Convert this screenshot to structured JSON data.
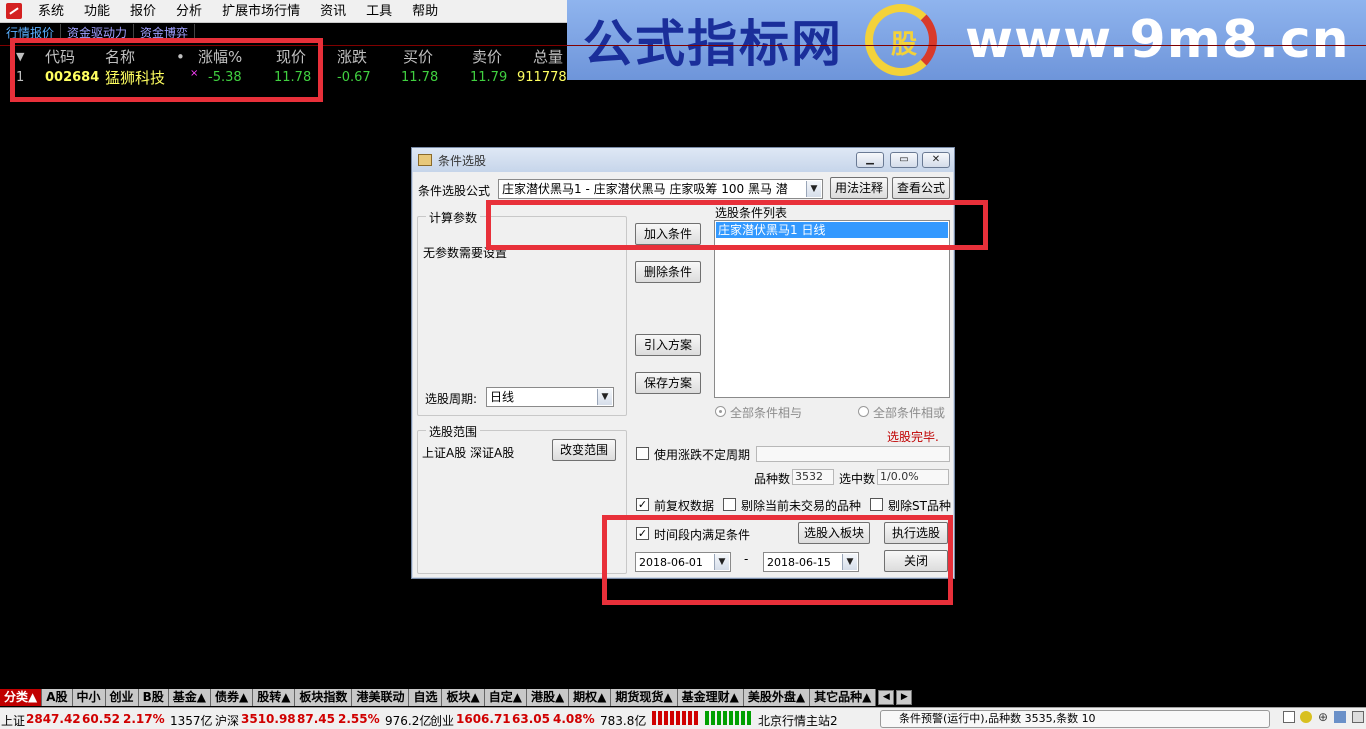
{
  "menu": [
    "系统",
    "功能",
    "报价",
    "分析",
    "扩展市场行情",
    "资讯",
    "工具",
    "帮助"
  ],
  "subtabs": [
    "行情报价",
    "资金驱动力",
    "资金博弈"
  ],
  "banner": {
    "title": "公式指标网",
    "logo_text": "股",
    "url": "www.9m8.cn"
  },
  "quote": {
    "headers": [
      "代码",
      "名称",
      "•",
      "涨幅%",
      "现价",
      "涨跌",
      "买价",
      "卖价",
      "总量"
    ],
    "row": {
      "index": "1",
      "code": "002684",
      "name": "猛狮科技",
      "flag": "×",
      "change_pct": "-5.38",
      "price": "11.78",
      "change": "-0.67",
      "bid": "11.78",
      "ask": "11.79",
      "volume": "911778"
    },
    "colors": {
      "up": "#ff4040",
      "down": "#40d040",
      "text": "#ffff60"
    }
  },
  "dialog": {
    "title": "条件选股",
    "formula_label": "条件选股公式",
    "formula_value": "庄家潜伏黑马1 - 庄家潜伏黑马  庄家吸筹 100  黑马 潜",
    "usage_button": "用法注释",
    "view_button": "查看公式",
    "params_group": "计算参数",
    "params_text": "无参数需要设置",
    "period_label": "选股周期:",
    "period_value": "日线",
    "add_button": "加入条件",
    "delete_button": "删除条件",
    "import_button": "引入方案",
    "save_button": "保存方案",
    "list_title": "选股条件列表",
    "list_items": [
      "庄家潜伏黑马1  日线"
    ],
    "radio_and": "全部条件相与",
    "radio_or": "全部条件相或",
    "status": "选股完毕.",
    "range_group": "选股范围",
    "range_text": "上证A股 深证A股",
    "change_range_button": "改变范围",
    "use_period_label": "使用涨跌不定周期",
    "count_label": "品种数",
    "count_value": "3532",
    "selected_label": "选中数",
    "selected_value": "1/0.0%",
    "fq_label": "前复权数据",
    "fq_checked": true,
    "exclude_untraded_label": "剔除当前未交易的品种",
    "exclude_st_label": "剔除ST品种",
    "time_condition_label": "时间段内满足条件",
    "time_condition_checked": true,
    "to_block_button": "选股入板块",
    "execute_button": "执行选股",
    "date_from": "2018-06-01",
    "date_sep": "-",
    "date_to": "2018-06-15",
    "close_button": "关闭"
  },
  "categories": [
    "分类▲",
    "A股",
    "中小",
    "创业",
    "B股",
    "基金▲",
    "债券▲",
    "股转▲",
    "板块指数",
    "港美联动",
    "自选",
    "板块▲",
    "自定▲",
    "港股▲",
    "期权▲",
    "期货现货▲",
    "基金理财▲",
    "美股外盘▲",
    "其它品种▲"
  ],
  "status": {
    "sh_label": "上证",
    "sh_index": "2847.42",
    "sh_change": "60.52",
    "sh_pct": "2.17%",
    "sh_amount": "1357亿",
    "hs_label": "沪深",
    "hs_index": "3510.98",
    "hs_change": "87.45",
    "hs_pct": "2.55%",
    "hs_amount": "976.2亿",
    "cy_label": "创业",
    "cy_index": "1606.71",
    "cy_change": "63.05",
    "cy_pct": "4.08%",
    "cy_amount": "783.8亿",
    "server": "北京行情主站2",
    "notice": "条件预警(运行中),品种数 3535,条数 10"
  }
}
